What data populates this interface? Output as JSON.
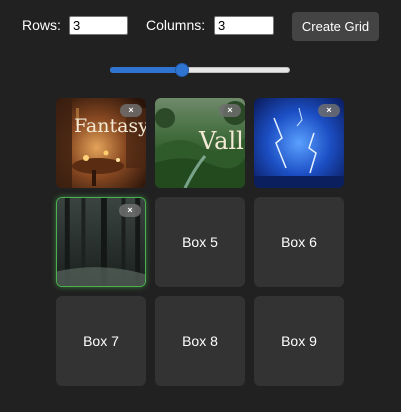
{
  "controls": {
    "rows_label": "Rows:",
    "rows_value": "3",
    "columns_label": "Columns:",
    "columns_value": "3",
    "create_button": "Create Grid"
  },
  "slider": {
    "value_fraction": 0.4
  },
  "grid": {
    "rows": 3,
    "columns": 3,
    "accent_color": "#4caf50",
    "cells": [
      {
        "type": "image",
        "art": "fantasy-tavern",
        "overlay_text": "Fantasy",
        "close": "×"
      },
      {
        "type": "image",
        "art": "green-valley",
        "overlay_text": "Valle",
        "close": "×"
      },
      {
        "type": "image",
        "art": "lightning-storm",
        "overlay_text": "",
        "close": "×"
      },
      {
        "type": "image",
        "art": "dark-forest",
        "overlay_text": "",
        "close": "×",
        "selected": true
      },
      {
        "type": "text",
        "label": "Box 5"
      },
      {
        "type": "text",
        "label": "Box 6"
      },
      {
        "type": "text",
        "label": "Box 7"
      },
      {
        "type": "text",
        "label": "Box 8"
      },
      {
        "type": "text",
        "label": "Box 9"
      }
    ]
  }
}
